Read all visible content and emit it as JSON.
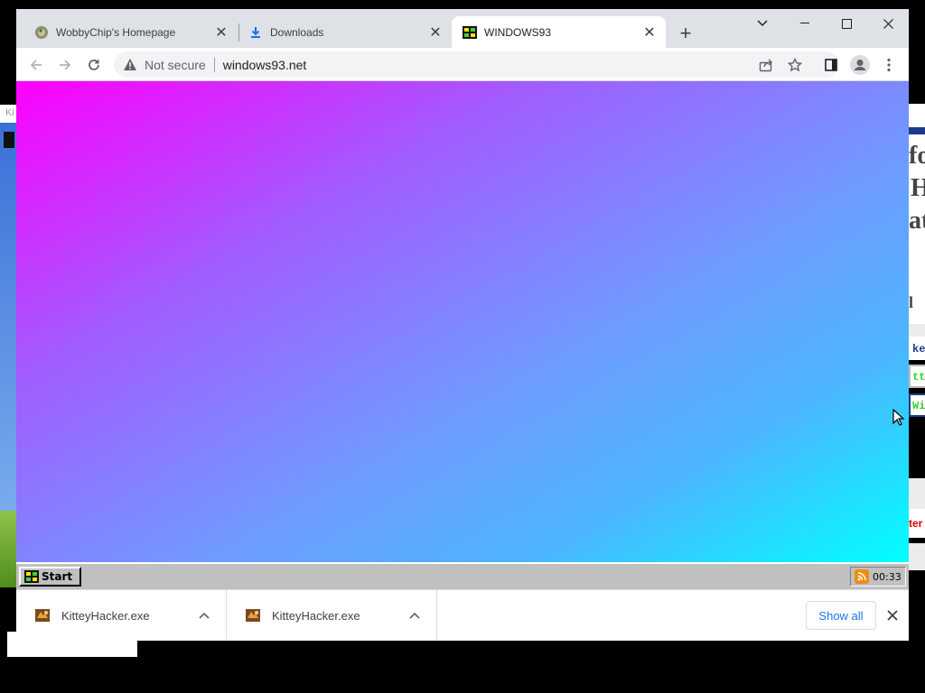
{
  "browser": {
    "tabs": [
      {
        "title": "WobbyChip's Homepage",
        "icon": "globe-favicon",
        "active": false
      },
      {
        "title": "Downloads",
        "icon": "download-icon",
        "active": false
      },
      {
        "title": "WINDOWS93",
        "icon": "windows93-favicon",
        "active": true
      }
    ],
    "omnibox": {
      "security_text": "Not secure",
      "url": "windows93.net"
    }
  },
  "windows93": {
    "start_label": "Start",
    "clock": "00:33",
    "colors": {
      "gradient_start": "#ff00ff",
      "gradient_end": "#00ffff",
      "taskbar": "#c0c0c0"
    }
  },
  "downloads": {
    "items": [
      {
        "filename": "KitteyHacker.exe"
      },
      {
        "filename": "KitteyHacker.exe"
      }
    ],
    "show_all_label": "Show all"
  },
  "background": {
    "left_strip_text": "Ki",
    "right_big_text": [
      "fo",
      "H",
      "at",
      "l"
    ],
    "right_box_texts": [
      "ke",
      "tt",
      "Wi"
    ],
    "right_red_text": "ter"
  }
}
